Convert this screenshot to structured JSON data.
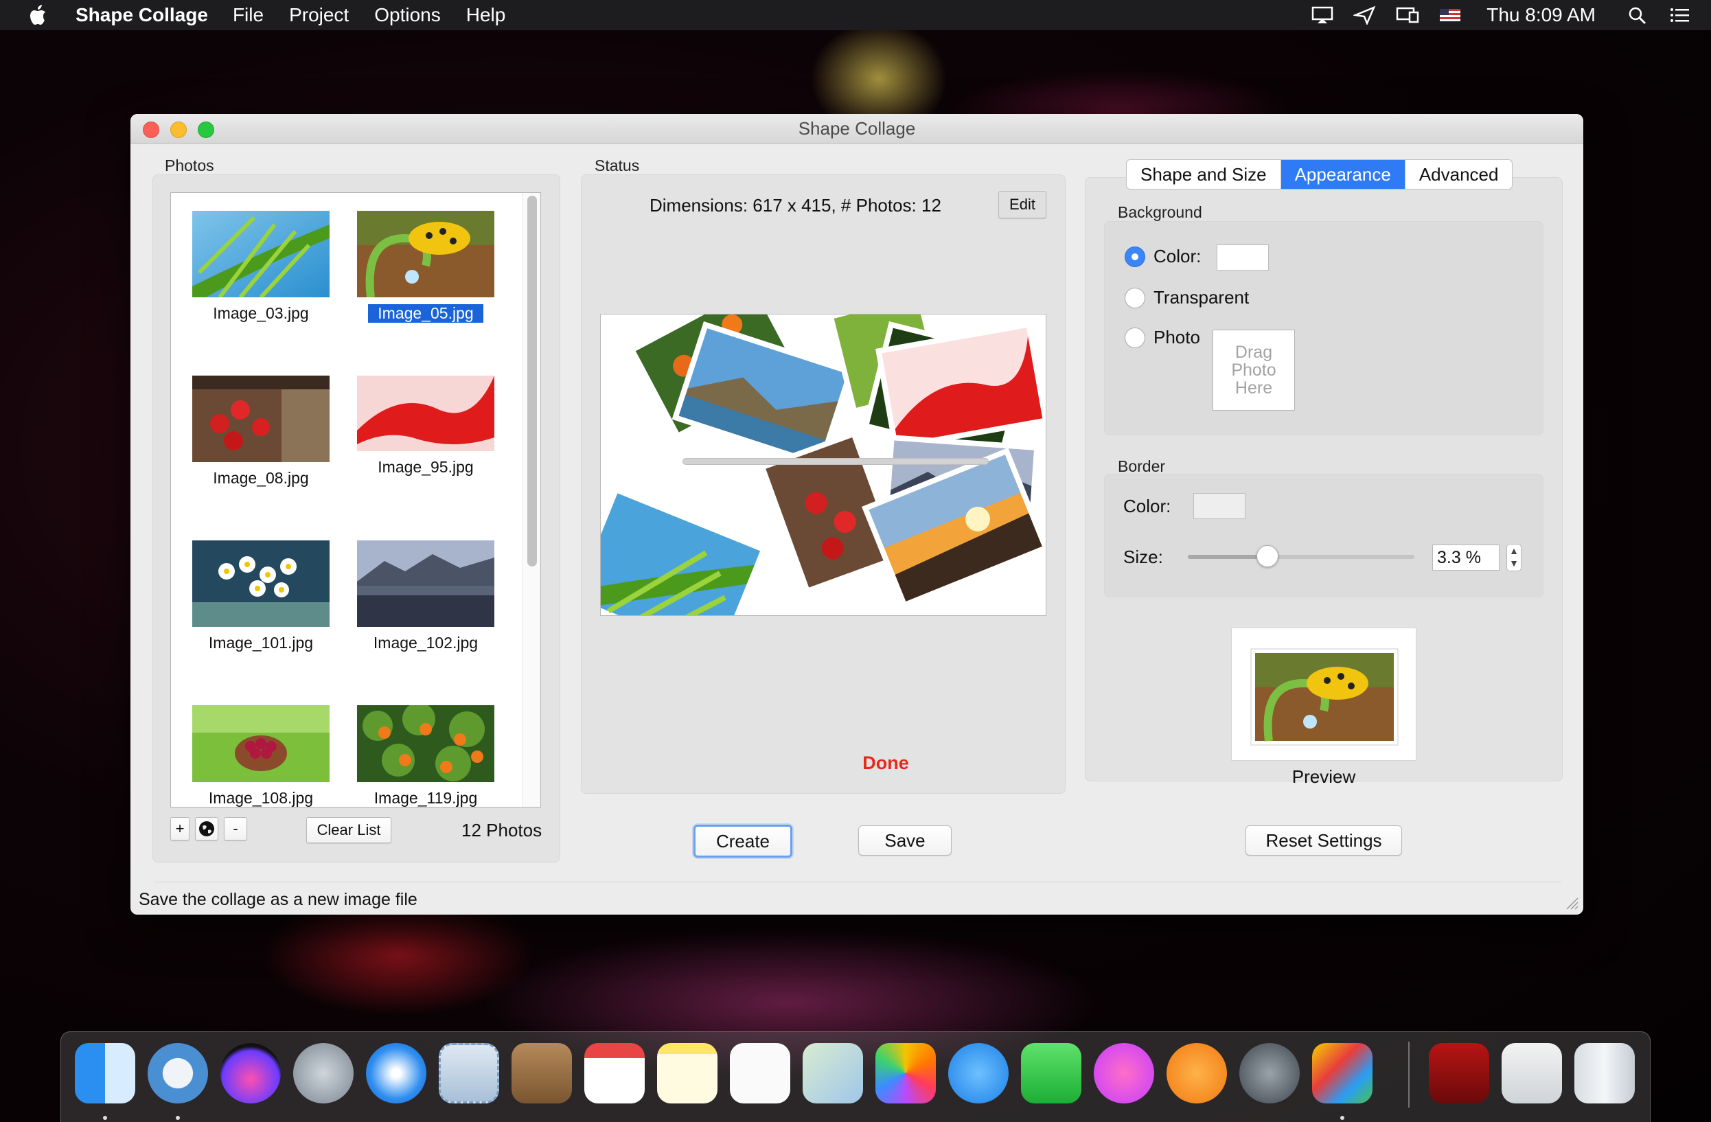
{
  "menubar": {
    "app_name": "Shape Collage",
    "items": [
      "File",
      "Project",
      "Options",
      "Help"
    ],
    "clock": "Thu 8:09 AM"
  },
  "window": {
    "title": "Shape Collage",
    "status_message": "Save the collage as a new image file"
  },
  "photos": {
    "group_label": "Photos",
    "items": [
      {
        "name": "Image_03.jpg",
        "selected": false
      },
      {
        "name": "Image_05.jpg",
        "selected": true
      },
      {
        "name": "Image_08.jpg",
        "selected": false
      },
      {
        "name": "Image_95.jpg",
        "selected": false
      },
      {
        "name": "Image_101.jpg",
        "selected": false
      },
      {
        "name": "Image_102.jpg",
        "selected": false
      },
      {
        "name": "Image_108.jpg",
        "selected": false
      },
      {
        "name": "Image_119.jpg",
        "selected": false
      }
    ],
    "add_label": "+",
    "remove_label": "-",
    "clear_label": "Clear List",
    "count_label": "12 Photos"
  },
  "status": {
    "group_label": "Status",
    "dimensions": "Dimensions: 617 x 415, # Photos: 12",
    "edit_label": "Edit",
    "result": "Done",
    "progress": 0
  },
  "actions": {
    "create_label": "Create",
    "save_label": "Save",
    "reset_label": "Reset Settings"
  },
  "settings": {
    "tabs": [
      {
        "label": "Shape and Size",
        "active": false
      },
      {
        "label": "Appearance",
        "active": true
      },
      {
        "label": "Advanced",
        "active": false
      }
    ],
    "background": {
      "group_label": "Background",
      "options": [
        "Color:",
        "Transparent",
        "Photo"
      ],
      "selected": "Color:",
      "drop_text": [
        "Drag",
        "Photo",
        "Here"
      ],
      "color": "#ffffff"
    },
    "border": {
      "group_label": "Border",
      "color_label": "Color:",
      "size_label": "Size:",
      "size_value": "3.3 %",
      "slider_fraction": 0.35,
      "color": "#eeeeee"
    },
    "preview_label": "Preview"
  },
  "colors": {
    "accent": "#2f7bf5",
    "done": "#e32b1c"
  }
}
